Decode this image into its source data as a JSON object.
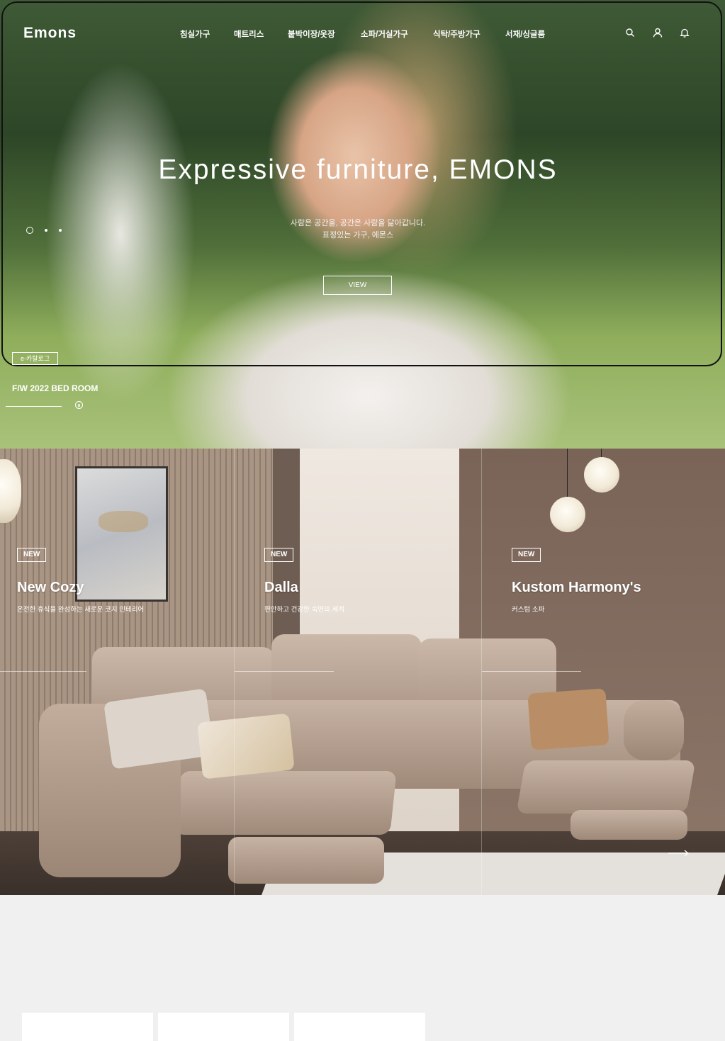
{
  "header": {
    "logo": "Emons",
    "nav": [
      "침실가구",
      "매트리스",
      "붙박이장/옷장",
      "소파/거실가구",
      "식탁/주방가구",
      "서재/싱글룸"
    ],
    "icons": [
      "search-icon",
      "user-icon",
      "bell-icon"
    ]
  },
  "hero": {
    "title": "Expressive furniture, EMONS",
    "subtitle_line1": "사람은 공간을, 공간은 사람을 닮아갑니다.",
    "subtitle_line2": "표정있는 가구, 에몬스",
    "view_label": "VIEW",
    "catalog_label": "e-카탈로그",
    "season_label": "F/W 2022 BED ROOM",
    "slides_total": 3,
    "slide_active": 1,
    "progress": 1.0
  },
  "products": [
    {
      "badge": "NEW",
      "title": "New Cozy",
      "desc": "온전한 휴식을 완성하는 새로운 코지 인테리어"
    },
    {
      "badge": "NEW",
      "title": "Dalla",
      "desc": "편안하고 건강한 숙면의 세계"
    },
    {
      "badge": "NEW",
      "title": "Kustom Harmony's",
      "desc": "커스텀 소파"
    }
  ],
  "colors": {
    "page_bg": "#f0f0f0",
    "frame": "#111111",
    "text": "#ffffff"
  }
}
